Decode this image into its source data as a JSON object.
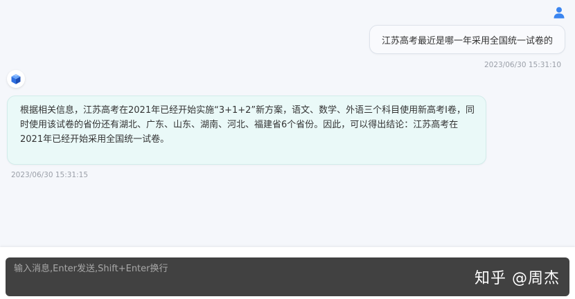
{
  "user": {
    "avatar_icon": "user-icon",
    "message": "江苏高考最近是哪一年采用全国统一试卷的",
    "timestamp": "2023/06/30 15:31:10"
  },
  "bot": {
    "avatar_icon": "cube-logo-icon",
    "message": "根据相关信息，江苏高考在2021年已经开始实施“3+1+2”新方案，语文、数学、外语三个科目使用新高考I卷，同时使用该试卷的省份还有湖北、广东、山东、湖南、河北、福建省6个省份。因此，可以得出结论：江苏高考在2021年已经开始采用全国统一试卷。",
    "timestamp": "2023/06/30 15:31:15"
  },
  "composer": {
    "placeholder": "输入消息,Enter发送,Shift+Enter换行"
  },
  "watermark": "知乎 @周杰",
  "colors": {
    "accent": "#3a85f0",
    "bot_bubble": "#eaf9f8",
    "user_bubble": "#f9fafd",
    "composer_bg": "#414141",
    "timestamp": "#9a9fa8"
  }
}
